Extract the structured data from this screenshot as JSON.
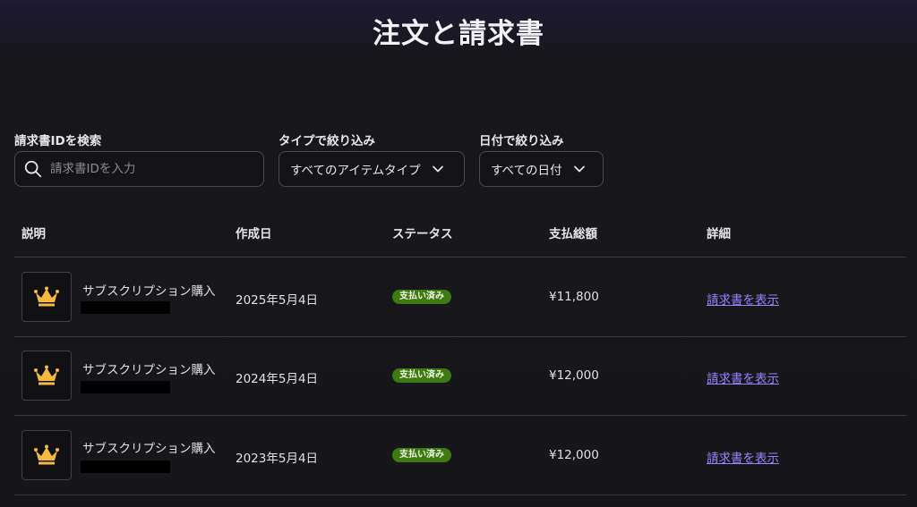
{
  "page": {
    "title": "注文と請求書"
  },
  "filters": {
    "search_label": "請求書IDを検索",
    "search_placeholder": "請求書IDを入力",
    "type_label": "タイプで絞り込み",
    "type_value": "すべてのアイテムタイプ",
    "date_label": "日付で絞り込み",
    "date_value": "すべての日付"
  },
  "table": {
    "headers": [
      "説明",
      "作成日",
      "ステータス",
      "支払総額",
      "詳細"
    ],
    "rows": [
      {
        "description": "サブスクリプション購入",
        "date": "2025年5月4日",
        "status": "支払い済み",
        "amount": "¥11,800",
        "details": "請求書を表示"
      },
      {
        "description": "サブスクリプション購入",
        "date": "2024年5月4日",
        "status": "支払い済み",
        "amount": "¥12,000",
        "details": "請求書を表示"
      },
      {
        "description": "サブスクリプション購入",
        "date": "2023年5月4日",
        "status": "支払い済み",
        "amount": "¥12,000",
        "details": "請求書を表示"
      }
    ]
  },
  "colors": {
    "accent_link": "#9b82ff",
    "badge_paid": "#3e7a10",
    "crown": "#f5b942"
  },
  "icons": {
    "search": "search-icon",
    "chevron": "chevron-down-icon",
    "product": "crown-icon"
  }
}
